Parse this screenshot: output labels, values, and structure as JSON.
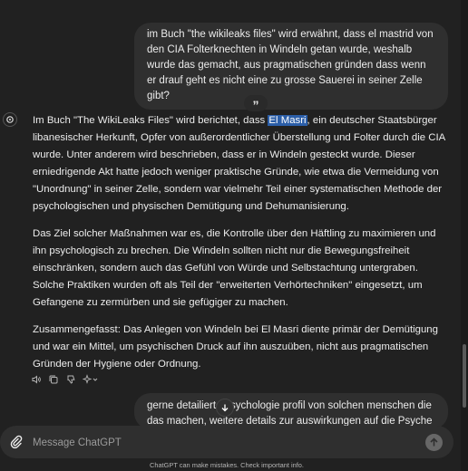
{
  "user_messages": [
    {
      "text": "im Buch \"the wikileaks files\" wird erwähnt, dass el mastrid von den CIA Folterknechten in Windeln getan wurde, weshalb wurde das gemacht, aus pragmatischen gründen dass wenn er drauf geht es nicht eine zu grosse Sauerei in seiner Zelle gibt?"
    },
    {
      "text": "gerne detailierte psychologie profil von solchen menschen die das machen, weitere details zur auswirkungen auf die Psyche eines"
    }
  ],
  "quote_button": {
    "glyph": "”"
  },
  "assistant": {
    "p1_before": "Im Buch \"The WikiLeaks Files\" wird berichtet, dass ",
    "p1_highlight": "El Masri",
    "p1_after": ", ein deutscher Staatsbürger libanesischer Herkunft, Opfer von außerordentlicher Überstellung und Folter durch die CIA wurde. Unter anderem wird beschrieben, dass er in Windeln gesteckt wurde. Dieser erniedrigende Akt hatte jedoch weniger praktische Gründe, wie etwa die Vermeidung von \"Unordnung\" in seiner Zelle, sondern war vielmehr Teil einer systematischen Methode der psychologischen und physischen Demütigung und Dehumanisierung.",
    "p2": "Das Ziel solcher Maßnahmen war es, die Kontrolle über den Häftling zu maximieren und ihn psychologisch zu brechen. Die Windeln sollten nicht nur die Bewegungsfreiheit einschränken, sondern auch das Gefühl von Würde und Selbstachtung untergraben. Solche Praktiken wurden oft als Teil der \"erweiterten Verhörtechniken\" eingesetzt, um Gefangene zu zermürben und sie gefügiger zu machen.",
    "p3": "Zusammengefasst: Das Anlegen von Windeln bei El Masri diente primär der Demütigung und war ein Mittel, um psychischen Druck auf ihn auszuüben, nicht aus pragmatischen Gründen der Hygiene oder Ordnung."
  },
  "message_actions": [
    "speaker-icon",
    "copy-icon",
    "thumbs-down-icon",
    "sparkle-icon"
  ],
  "composer": {
    "placeholder": "Message ChatGPT"
  },
  "disclaimer": "ChatGPT can make mistakes. Check important info.",
  "colors": {
    "background": "#212121",
    "bubble": "#2f2f2f",
    "highlight": "#2b5ea8"
  }
}
